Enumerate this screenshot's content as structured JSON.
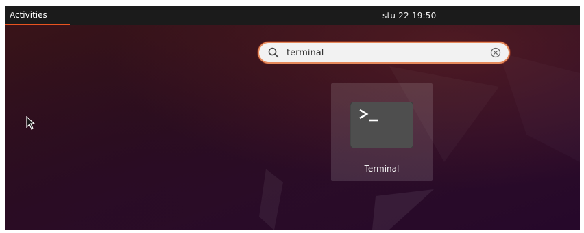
{
  "topbar": {
    "activities_label": "Activities",
    "clock": "stu 22  19:50"
  },
  "search": {
    "value": "terminal",
    "icon": "search-icon",
    "clear_icon": "clear-icon"
  },
  "results": [
    {
      "label": "Terminal",
      "icon": "terminal-icon"
    }
  ],
  "colors": {
    "accent": "#e95420",
    "topbar": "#1b1b1b",
    "tile": "#4e4e4e"
  }
}
